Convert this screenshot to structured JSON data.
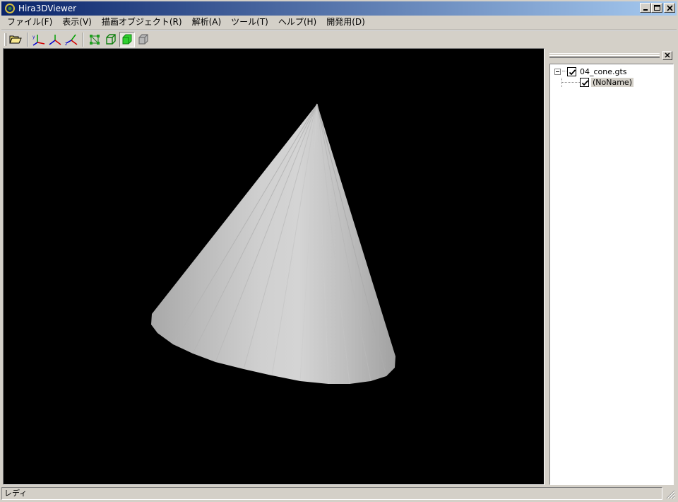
{
  "window": {
    "title": "Hira3DViewer"
  },
  "menu": [
    {
      "label": "ファイル(F)"
    },
    {
      "label": "表示(V)"
    },
    {
      "label": "描画オブジェクト(R)"
    },
    {
      "label": "解析(A)"
    },
    {
      "label": "ツール(T)"
    },
    {
      "label": "ヘルプ(H)"
    },
    {
      "label": "開発用(D)"
    }
  ],
  "toolbar": {
    "buttons": [
      {
        "icon": "folder-open-icon"
      },
      {
        "icon": "axis-xy-icon"
      },
      {
        "icon": "axis-yz-icon"
      },
      {
        "icon": "axis-zx-icon"
      },
      {
        "icon": "vertex-mode-icon"
      },
      {
        "icon": "wireframe-mode-icon"
      },
      {
        "icon": "solid-mode-icon",
        "pressed": true
      },
      {
        "icon": "hidden-mode-icon"
      }
    ]
  },
  "scene": {
    "background": "#000000",
    "object_color": "#c8c8c8"
  },
  "tree": {
    "root": {
      "label": "04_cone.gts",
      "checked": true,
      "expanded": true
    },
    "children": [
      {
        "label": "(NoName)",
        "checked": true,
        "selected": true
      }
    ]
  },
  "status": {
    "text": "レディ"
  },
  "colors": {
    "title_start": "#0a246a",
    "title_end": "#a6caf0",
    "face": "#d4d0c8"
  }
}
